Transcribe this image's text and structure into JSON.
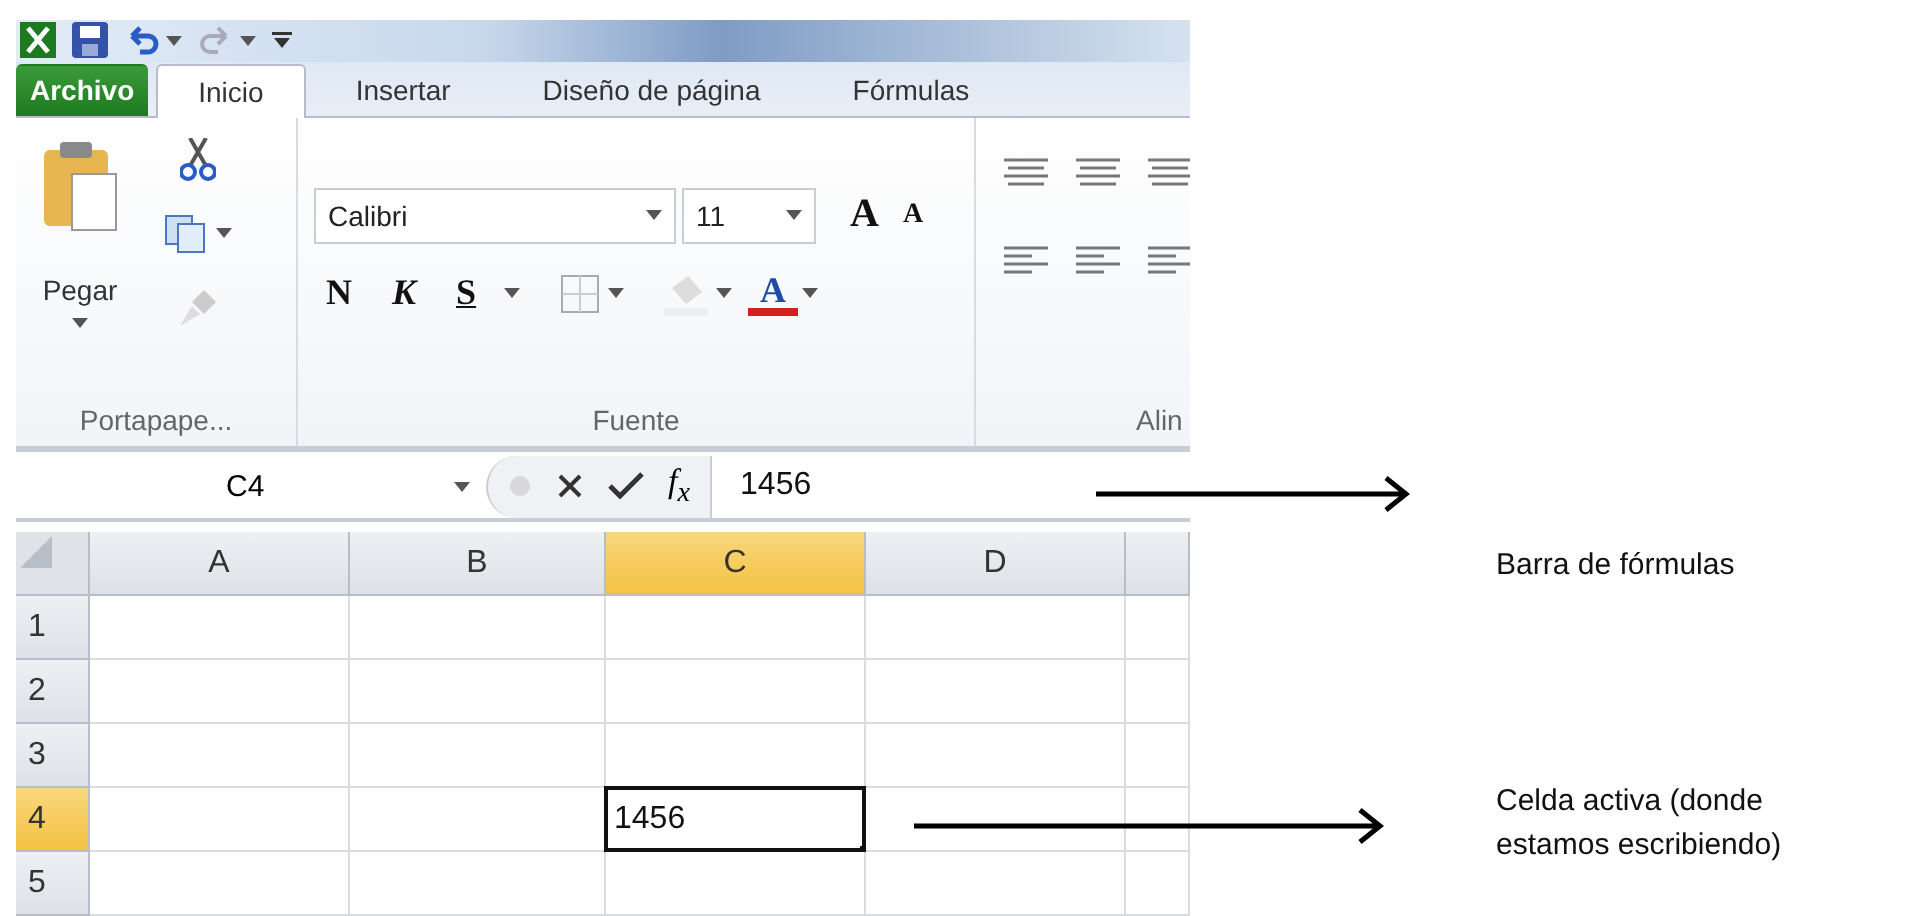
{
  "tabs": [
    {
      "label": "Archivo",
      "kind": "file",
      "selected": false
    },
    {
      "label": "Inicio",
      "kind": "tab",
      "selected": true
    },
    {
      "label": "Insertar",
      "kind": "tab",
      "selected": false
    },
    {
      "label": "Diseño de página",
      "kind": "tab",
      "selected": false
    },
    {
      "label": "Fórmulas",
      "kind": "tab",
      "selected": false
    }
  ],
  "ribbon": {
    "clipboard": {
      "paste_label": "Pegar",
      "group_label": "Portapape..."
    },
    "font": {
      "font_name": "Calibri",
      "font_size": "11",
      "grow_font": "A",
      "shrink_font": "A",
      "bold": "N",
      "italic": "K",
      "underline": "S",
      "font_color": "A",
      "group_label": "Fuente"
    },
    "alignment": {
      "group_label": "Alin"
    }
  },
  "formula_bar": {
    "name_box": "C4",
    "function_label": "f$_{x}$",
    "formula": "1456"
  },
  "sheet": {
    "columns": [
      {
        "label": "A",
        "selected": false
      },
      {
        "label": "B",
        "selected": false
      },
      {
        "label": "C",
        "selected": true
      },
      {
        "label": "D",
        "selected": false
      }
    ],
    "rows": [
      {
        "label": "1",
        "selected": false
      },
      {
        "label": "2",
        "selected": false
      },
      {
        "label": "3",
        "selected": false
      },
      {
        "label": "4",
        "selected": true
      },
      {
        "label": "5",
        "selected": false
      }
    ],
    "active_cell": {
      "value": "1456"
    }
  },
  "annotations": [
    {
      "text": "Barra de fórmulas"
    },
    {
      "text": "Celda activa (donde estamos escribiendo)"
    }
  ]
}
